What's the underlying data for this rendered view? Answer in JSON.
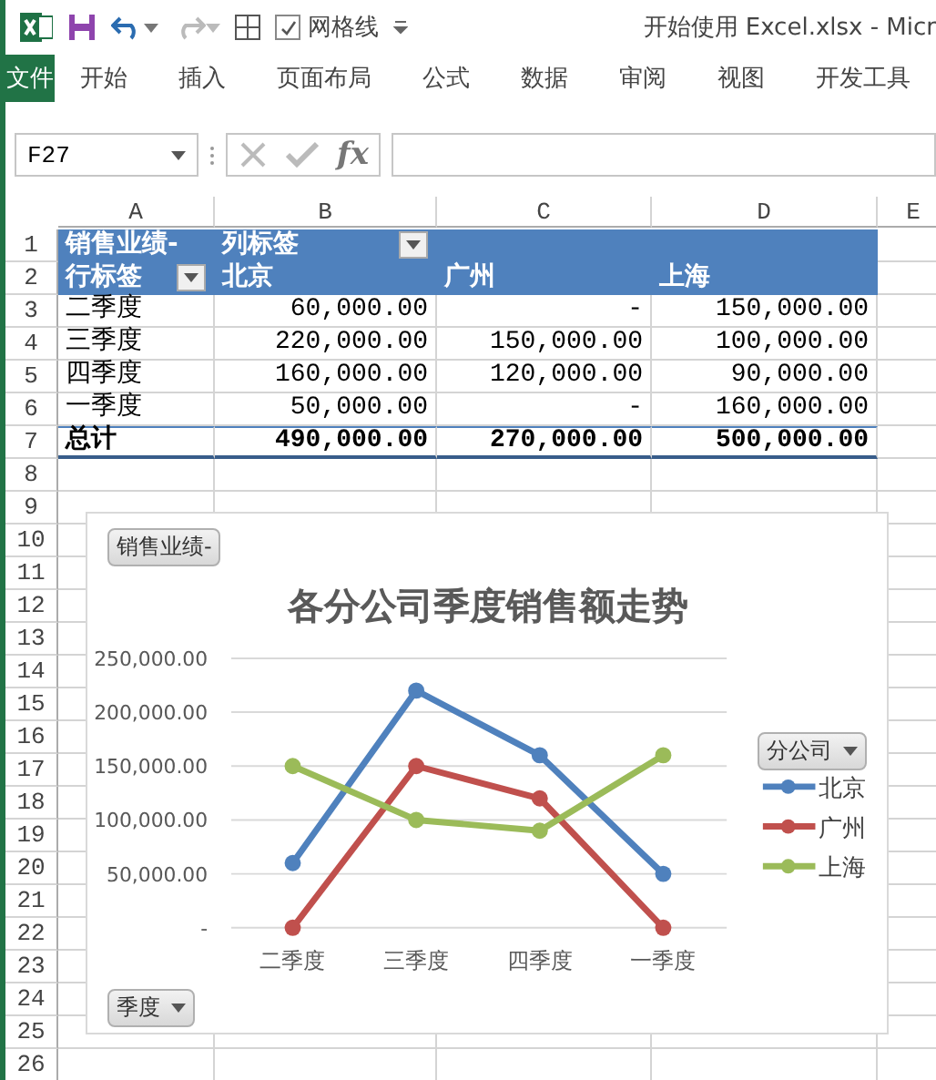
{
  "quick_access": {
    "gridlines_label": "网格线",
    "gridlines_checked": true
  },
  "window": {
    "title": "开始使用 Excel.xlsx - Micr"
  },
  "ribbon_tabs": [
    {
      "label": "文件",
      "kind": "file"
    },
    {
      "label": "开始",
      "kind": "tab"
    },
    {
      "label": "插入",
      "kind": "tab"
    },
    {
      "label": "页面布局",
      "kind": "tab"
    },
    {
      "label": "公式",
      "kind": "tab"
    },
    {
      "label": "数据",
      "kind": "tab"
    },
    {
      "label": "审阅",
      "kind": "tab"
    },
    {
      "label": "视图",
      "kind": "tab"
    },
    {
      "label": "开发工具",
      "kind": "tab"
    }
  ],
  "formula_bar": {
    "name_box": "F27",
    "function_button": "fx"
  },
  "columns": [
    "A",
    "B",
    "C",
    "D",
    "E"
  ],
  "rows": [
    "1",
    "2",
    "3",
    "4",
    "5",
    "6",
    "7",
    "8",
    "9",
    "10",
    "11",
    "12",
    "13",
    "14",
    "15",
    "16",
    "17",
    "18",
    "19",
    "20",
    "21",
    "22",
    "23",
    "24",
    "25",
    "26"
  ],
  "pivot": {
    "value_field": "销售业绩-",
    "column_label": "列标签",
    "row_label": "行标签",
    "column_items": [
      "北京",
      "广州",
      "上海"
    ],
    "body": [
      {
        "label": "二季度",
        "cells": [
          "60,000.00",
          "-",
          "150,000.00"
        ]
      },
      {
        "label": "三季度",
        "cells": [
          "220,000.00",
          "150,000.00",
          "100,000.00"
        ]
      },
      {
        "label": "四季度",
        "cells": [
          "160,000.00",
          "120,000.00",
          "90,000.00"
        ]
      },
      {
        "label": "一季度",
        "cells": [
          "50,000.00",
          "-",
          "160,000.00"
        ]
      }
    ],
    "total": {
      "label": "总计",
      "cells": [
        "490,000.00",
        "270,000.00",
        "500,000.00"
      ]
    }
  },
  "chart": {
    "value_button": "销售业绩-",
    "legend_button": "分公司",
    "axis_button": "季度",
    "chart_data": {
      "type": "line",
      "title": "各分公司季度销售额走势",
      "categories": [
        "二季度",
        "三季度",
        "四季度",
        "一季度"
      ],
      "series": [
        {
          "name": "北京",
          "color": "#4f81bd",
          "marker": "circle",
          "values": [
            60000,
            220000,
            160000,
            50000
          ]
        },
        {
          "name": "广州",
          "color": "#c0504d",
          "marker": "circle",
          "values": [
            0,
            150000,
            120000,
            0
          ]
        },
        {
          "name": "上海",
          "color": "#9bbb59",
          "marker": "circle",
          "values": [
            150000,
            100000,
            90000,
            160000
          ]
        }
      ],
      "grid": true,
      "legend": true,
      "ylim": [
        0,
        250000
      ],
      "yticks": [
        {
          "value": 0,
          "label": "-"
        },
        {
          "value": 50000,
          "label": "50,000.00"
        },
        {
          "value": 100000,
          "label": "100,000.00"
        },
        {
          "value": 150000,
          "label": "150,000.00"
        },
        {
          "value": 200000,
          "label": "200,000.00"
        },
        {
          "value": 250000,
          "label": "250,000.00"
        }
      ]
    }
  }
}
